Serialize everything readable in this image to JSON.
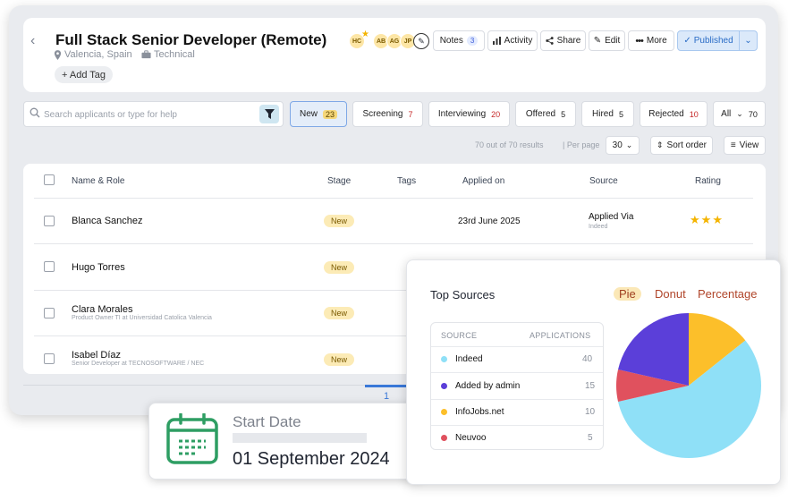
{
  "job": {
    "title": "Full Stack Senior Developer (Remote)",
    "location": "Valencia, Spain",
    "department": "Technical",
    "add_tag": "+ Add Tag"
  },
  "team": {
    "avatars": [
      "HC",
      "AB",
      "AG",
      "JP"
    ],
    "lead_icon": "star-icon",
    "edit_icon": "pencil-icon"
  },
  "toolbar": {
    "notes_label": "Notes",
    "notes_count": "3",
    "activity_label": "Activity",
    "share_label": "Share",
    "edit_label": "Edit",
    "more_label": "More",
    "published_label": "Published"
  },
  "search": {
    "placeholder": "Search applicants or type for help"
  },
  "stages": [
    {
      "label": "New",
      "count": "23"
    },
    {
      "label": "Screening",
      "count": "7"
    },
    {
      "label": "Interviewing",
      "count": "20"
    },
    {
      "label": "Offered",
      "count": "5"
    },
    {
      "label": "Hired",
      "count": "5"
    },
    {
      "label": "Rejected",
      "count": "10"
    },
    {
      "label": "All",
      "count": "70"
    }
  ],
  "listing": {
    "results": "70 out of 70 results",
    "per_page_label": "Per page",
    "per_page_value": "30",
    "sort_label": "Sort order",
    "view_label": "View"
  },
  "table": {
    "columns": [
      "Name & Role",
      "Stage",
      "Tags",
      "Applied on",
      "Source",
      "Rating"
    ],
    "rows": [
      {
        "name": "Blanca Sanchez",
        "role": "",
        "stage": "New",
        "applied": "23rd June 2025",
        "source": "Applied Via",
        "source_detail": "Indeed",
        "rating": 3
      },
      {
        "name": "Hugo Torres",
        "role": "",
        "stage": "New",
        "applied": "",
        "source": "",
        "source_detail": "",
        "rating": 0
      },
      {
        "name": "Clara Morales",
        "role": "Product Owner TI at Universidad Catolica Valencia",
        "stage": "New",
        "applied": "",
        "source": "",
        "source_detail": "",
        "rating": 0
      },
      {
        "name": "Isabel Díaz",
        "role": "Senior Developer at TECNOSOFTWARE / NEC",
        "stage": "New",
        "applied": "",
        "source": "",
        "source_detail": "",
        "rating": 0
      }
    ],
    "page": "1"
  },
  "start_date": {
    "label": "Start Date",
    "value": "01 September 2024",
    "icon": "calendar-icon",
    "accent": "#2e9e63"
  },
  "top_sources": {
    "title": "Top Sources",
    "view_options": [
      "Pie",
      "Donut",
      "Percentage"
    ],
    "selected_view": "Pie",
    "col_source": "SOURCE",
    "col_applications": "APPLICATIONS",
    "items": [
      {
        "name": "Indeed",
        "value": "40",
        "color": "#8fe0f7"
      },
      {
        "name": "Added by admin",
        "value": "15",
        "color": "#5b3fd9"
      },
      {
        "name": "InfoJobs.net",
        "value": "10",
        "color": "#fcbf2a"
      },
      {
        "name": "Neuvoo",
        "value": "5",
        "color": "#e0515e"
      }
    ]
  },
  "chart_data": {
    "type": "pie",
    "categories": [
      "Indeed",
      "Added by admin",
      "InfoJobs.net",
      "Neuvoo"
    ],
    "values": [
      40,
      15,
      10,
      5
    ],
    "colors": [
      "#8fe0f7",
      "#5b3fd9",
      "#fcbf2a",
      "#e0515e"
    ],
    "title": "Top Sources"
  }
}
